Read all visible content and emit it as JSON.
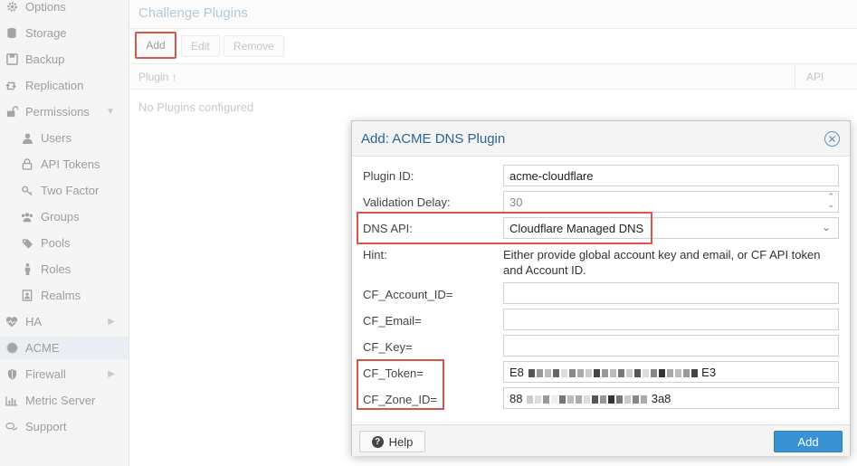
{
  "sidebar": {
    "items": [
      {
        "label": "Options",
        "icon": "gear-icon"
      },
      {
        "label": "Storage",
        "icon": "database-icon"
      },
      {
        "label": "Backup",
        "icon": "floppy-icon"
      },
      {
        "label": "Replication",
        "icon": "retweet-icon"
      },
      {
        "label": "Permissions",
        "icon": "unlock-icon"
      },
      {
        "label": "Users",
        "icon": "user-icon"
      },
      {
        "label": "API Tokens",
        "icon": "lock-icon"
      },
      {
        "label": "Two Factor",
        "icon": "key-icon"
      },
      {
        "label": "Groups",
        "icon": "users-icon"
      },
      {
        "label": "Pools",
        "icon": "tags-icon"
      },
      {
        "label": "Roles",
        "icon": "male-icon"
      },
      {
        "label": "Realms",
        "icon": "address-book-icon"
      },
      {
        "label": "HA",
        "icon": "heartbeat-icon"
      },
      {
        "label": "ACME",
        "icon": "certificate-icon"
      },
      {
        "label": "Firewall",
        "icon": "shield-icon"
      },
      {
        "label": "Metric Server",
        "icon": "bar-chart-icon"
      },
      {
        "label": "Support",
        "icon": "comments-icon"
      }
    ]
  },
  "main": {
    "title": "Challenge Plugins",
    "toolbar": {
      "add": "Add",
      "edit": "Edit",
      "remove": "Remove"
    },
    "grid": {
      "col_plugin": "Plugin ↑",
      "col_api": "API",
      "empty": "No Plugins configured"
    }
  },
  "dialog": {
    "title": "Add: ACME DNS Plugin",
    "fields": {
      "plugin_id": {
        "label": "Plugin ID:",
        "value": "acme-cloudflare"
      },
      "validation_delay": {
        "label": "Validation Delay:",
        "value": "30"
      },
      "dns_api": {
        "label": "DNS API:",
        "value": "Cloudflare Managed DNS"
      },
      "hint": {
        "label": "Hint:",
        "value": "Either provide global account key and email, or CF API token and Account ID."
      },
      "cf_account_id": {
        "label": "CF_Account_ID=",
        "value": ""
      },
      "cf_email": {
        "label": "CF_Email=",
        "value": ""
      },
      "cf_key": {
        "label": "CF_Key=",
        "value": ""
      },
      "cf_token": {
        "label": "CF_Token=",
        "value_start": "E8",
        "value_end": "E3"
      },
      "cf_zone_id": {
        "label": "CF_Zone_ID=",
        "value_start": "88",
        "value_end": "3a8"
      }
    },
    "help_label": "Help",
    "add_label": "Add"
  },
  "colors": {
    "accent": "#3892d4",
    "highlight_box": "#d9544a",
    "title_blue": "#2a6496"
  }
}
